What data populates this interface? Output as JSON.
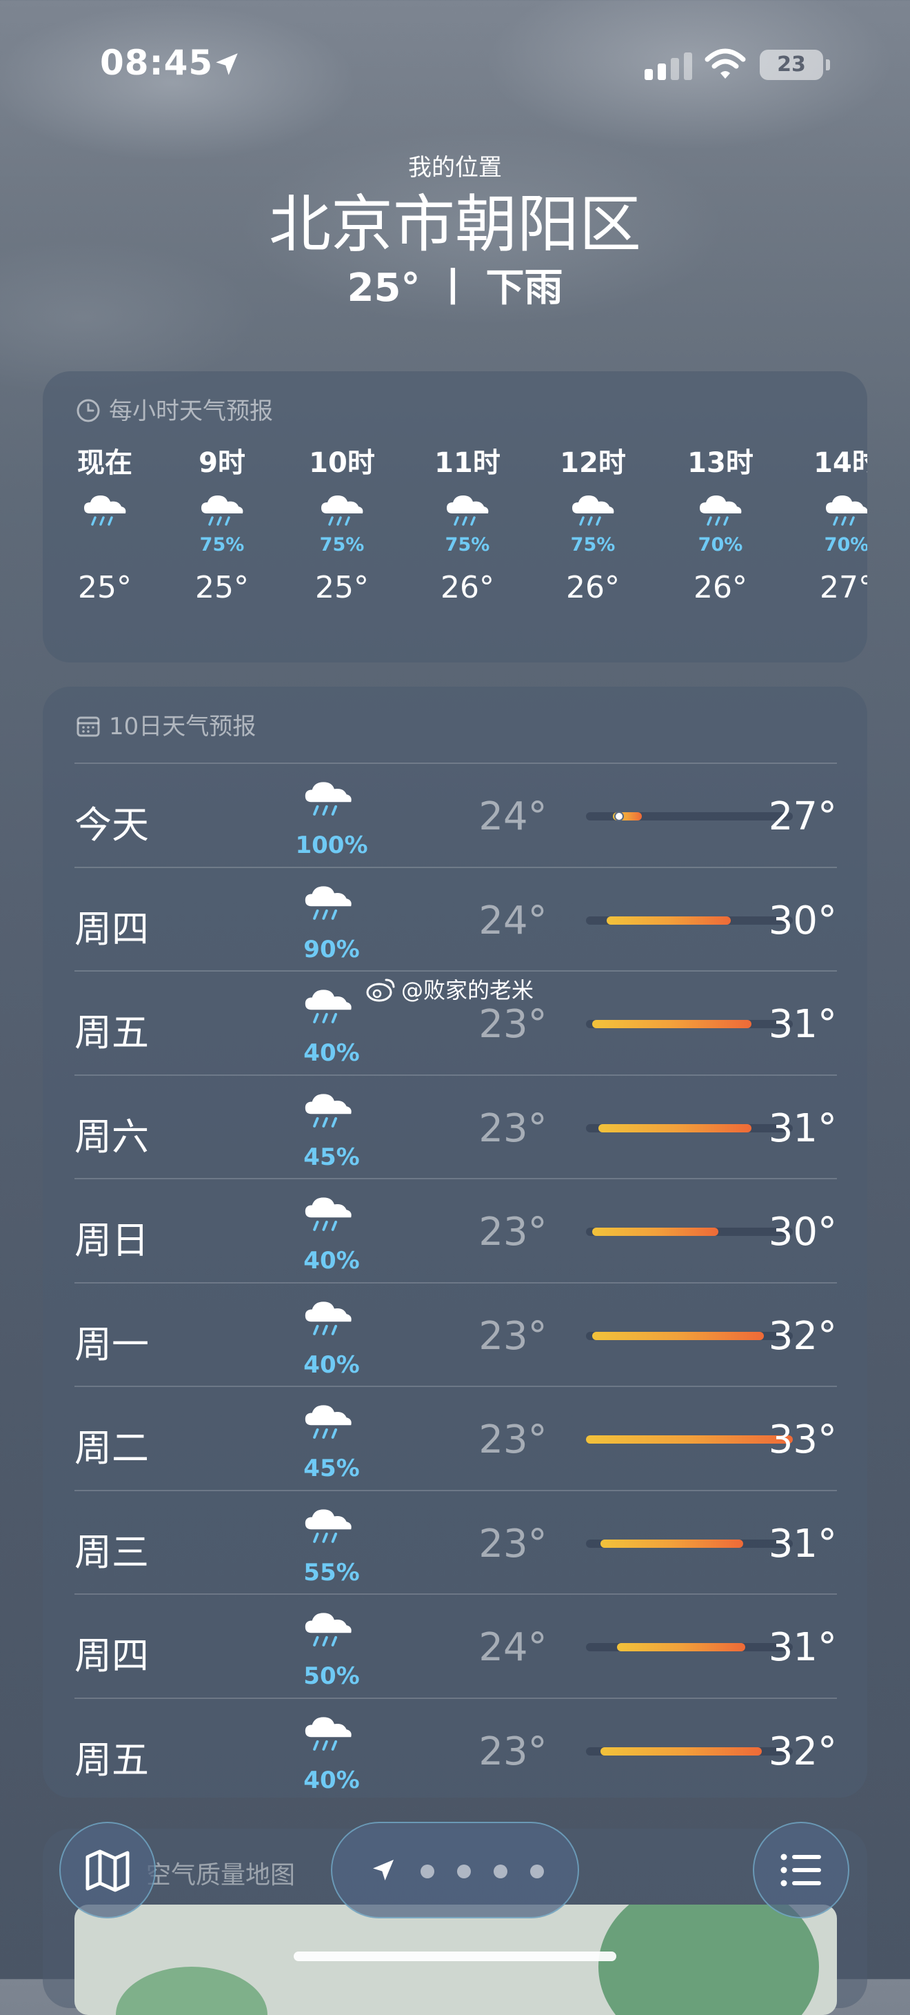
{
  "status_bar": {
    "time": "08:45",
    "battery": "23"
  },
  "location": {
    "label": "我的位置",
    "city": "北京市朝阳区",
    "temp": "25°",
    "separator": "丨",
    "condition": "下雨"
  },
  "hourly": {
    "title": "每小时天气预报",
    "items": [
      {
        "time": "现在",
        "pop": "",
        "temp": "25°"
      },
      {
        "time": "9时",
        "pop": "75%",
        "temp": "25°"
      },
      {
        "time": "10时",
        "pop": "75%",
        "temp": "25°"
      },
      {
        "time": "11时",
        "pop": "75%",
        "temp": "26°"
      },
      {
        "time": "12时",
        "pop": "75%",
        "temp": "26°"
      },
      {
        "time": "13时",
        "pop": "70%",
        "temp": "26°"
      },
      {
        "time": "14时",
        "pop": "70%",
        "temp": "27°"
      }
    ]
  },
  "daily": {
    "title": "10日天气预报",
    "range_min": 23,
    "range_max": 33,
    "items": [
      {
        "day": "今天",
        "pop": "100%",
        "low": "24°",
        "high": "27°",
        "bar_from": 24.3,
        "bar_to": 25.7,
        "current": 24.6
      },
      {
        "day": "周四",
        "pop": "90%",
        "low": "24°",
        "high": "30°",
        "bar_from": 24,
        "bar_to": 30
      },
      {
        "day": "周五",
        "pop": "40%",
        "low": "23°",
        "high": "31°",
        "bar_from": 23.3,
        "bar_to": 31
      },
      {
        "day": "周六",
        "pop": "45%",
        "low": "23°",
        "high": "31°",
        "bar_from": 23.6,
        "bar_to": 31
      },
      {
        "day": "周日",
        "pop": "40%",
        "low": "23°",
        "high": "30°",
        "bar_from": 23.3,
        "bar_to": 29.4
      },
      {
        "day": "周一",
        "pop": "40%",
        "low": "23°",
        "high": "32°",
        "bar_from": 23.3,
        "bar_to": 31.6
      },
      {
        "day": "周二",
        "pop": "45%",
        "low": "23°",
        "high": "33°",
        "bar_from": 23,
        "bar_to": 33
      },
      {
        "day": "周三",
        "pop": "55%",
        "low": "23°",
        "high": "31°",
        "bar_from": 23.7,
        "bar_to": 30.6
      },
      {
        "day": "周四",
        "pop": "50%",
        "low": "24°",
        "high": "31°",
        "bar_from": 24.5,
        "bar_to": 30.7
      },
      {
        "day": "周五",
        "pop": "40%",
        "low": "23°",
        "high": "32°",
        "bar_from": 23.7,
        "bar_to": 31.5
      }
    ]
  },
  "watermark": "@败家的老米",
  "air_quality": {
    "title": "空气质量地图"
  },
  "bottom_bar": {
    "map_icon": "map-icon",
    "list_icon": "list-icon",
    "page_dots": 4
  }
}
